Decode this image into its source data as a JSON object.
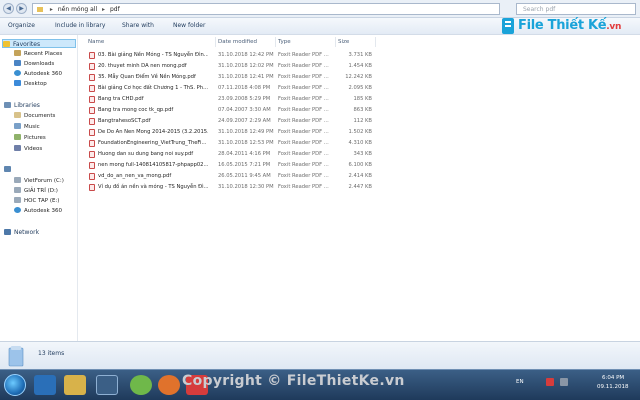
{
  "address": {
    "crumbs": [
      "nền móng all",
      "pdf"
    ]
  },
  "search": {
    "placeholder": "Search pdf"
  },
  "toolbar": {
    "organize": "Organize",
    "include": "Include in library",
    "share": "Share with",
    "new_folder": "New folder"
  },
  "watermark": {
    "brand": "File Thiết Kế",
    "suffix": ".vn"
  },
  "nav": {
    "favorites": "Favorites",
    "recent": "Recent Places",
    "downloads": "Downloads",
    "autodesk1": "Autodesk 360",
    "desktop": "Desktop",
    "libraries": "Libraries",
    "documents": "Documents",
    "music": "Music",
    "pictures": "Pictures",
    "videos": "Videos",
    "computer": "",
    "drive_c": "VietForum (C:)",
    "drive_d": "GIẢI TRÍ (D:)",
    "drive_e": "HOC TAP (E:)",
    "autodesk2": "Autodesk 360",
    "network": "Network"
  },
  "columns": {
    "name": "Name",
    "date": "Date modified",
    "type": "Type",
    "size": "Size"
  },
  "files": [
    {
      "name": "03. Bài giảng Nền Móng - TS Nguyễn Đìn...",
      "date": "31.10.2018 12:42 PM",
      "type": "Foxit Reader PDF ...",
      "size": "3.731 KB"
    },
    {
      "name": "20. thuyet minh DA nen mong.pdf",
      "date": "31.10.2018 12:02 PM",
      "type": "Foxit Reader PDF ...",
      "size": "1.454 KB"
    },
    {
      "name": "35. Mẫy Quan Điểm Về Nền Móng.pdf",
      "date": "31.10.2018 12:41 PM",
      "type": "Foxit Reader PDF ...",
      "size": "12.242 KB"
    },
    {
      "name": "Bài giảng Cơ học đất Chương 1 - ThS. Ph...",
      "date": "07.11.2018 4:08 PM",
      "type": "Foxit Reader PDF ...",
      "size": "2.095 KB"
    },
    {
      "name": "Bang tra CHD.pdf",
      "date": "23.09.2008 5:29 PM",
      "type": "Foxit Reader PDF ...",
      "size": "185 KB"
    },
    {
      "name": "Bang tra mong coc tk_qp.pdf",
      "date": "07.04.2007 3:30 AM",
      "type": "Foxit Reader PDF ...",
      "size": "863 KB"
    },
    {
      "name": "BangtrahesoSCT.pdf",
      "date": "24.09.2007 2:29 AM",
      "type": "Foxit Reader PDF ...",
      "size": "112 KB"
    },
    {
      "name": "De Do An Nen Mong 2014-2015 (3.2.2015...",
      "date": "31.10.2018 12:49 PM",
      "type": "Foxit Reader PDF ...",
      "size": "1.502 KB"
    },
    {
      "name": "FoundationEngineering_VietTrung_TheFi...",
      "date": "31.10.2018 12:53 PM",
      "type": "Foxit Reader PDF ...",
      "size": "4.310 KB"
    },
    {
      "name": "Huong dan su dung bang noi suy.pdf",
      "date": "28.04.2011 4:16 PM",
      "type": "Foxit Reader PDF ...",
      "size": "343 KB"
    },
    {
      "name": "nen mong full-140814105817-phpapp02....",
      "date": "16.05.2015 7:21 PM",
      "type": "Foxit Reader PDF ...",
      "size": "6.100 KB"
    },
    {
      "name": "vd_do_an_nen_va_mong.pdf",
      "date": "26.05.2011 9:45 AM",
      "type": "Foxit Reader PDF ...",
      "size": "2.414 KB"
    },
    {
      "name": "Ví dụ đồ án nền và móng - TS Nguyễn Đì...",
      "date": "31.10.2018 12:30 PM",
      "type": "Foxit Reader PDF ...",
      "size": "2.447 KB"
    }
  ],
  "details": {
    "count": "13 items"
  },
  "taskbar": {
    "copyright": "Copyright © FileThietKe.vn",
    "lang": "EN",
    "time": "6:04 PM",
    "date": "09.11.2018"
  }
}
